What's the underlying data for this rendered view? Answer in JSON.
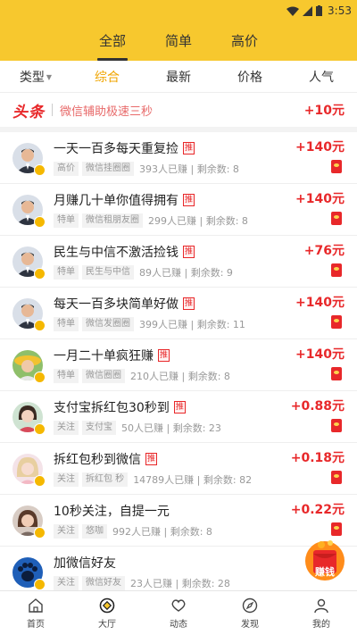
{
  "status_bar": {
    "time": "3:53"
  },
  "top_tabs": [
    {
      "label": "全部",
      "active": true
    },
    {
      "label": "简单",
      "active": false
    },
    {
      "label": "高价",
      "active": false
    }
  ],
  "filters": [
    {
      "label": "类型",
      "active": false,
      "has_caret": true
    },
    {
      "label": "综合",
      "active": true
    },
    {
      "label": "最新",
      "active": false
    },
    {
      "label": "价格",
      "active": false
    },
    {
      "label": "人气",
      "active": false
    }
  ],
  "banner": {
    "logo": "头条",
    "text": "微信辅助极速三秒",
    "amount": "+10元"
  },
  "tasks": [
    {
      "title": "一天一百多每天重复捡",
      "tag": "推",
      "chips": [
        "高价",
        "微信挂圈圈"
      ],
      "stats": "393人已赚 | 剩余数: 8",
      "amount": "+140元",
      "avatar": "man"
    },
    {
      "title": "月赚几十单你值得拥有",
      "tag": "推",
      "chips": [
        "特单",
        "微信租朋友圈"
      ],
      "stats": "299人已赚 | 剩余数: 8",
      "amount": "+140元",
      "avatar": "man"
    },
    {
      "title": "民生与中信不激活捡钱",
      "tag": "推",
      "chips": [
        "特单",
        "民生与中信"
      ],
      "stats": "89人已赚 | 剩余数: 9",
      "amount": "+76元",
      "avatar": "man"
    },
    {
      "title": "每天一百多块简单好做",
      "tag": "推",
      "chips": [
        "特单",
        "微信发圈圈"
      ],
      "stats": "399人已赚 | 剩余数: 11",
      "amount": "+140元",
      "avatar": "man"
    },
    {
      "title": "一月二十单疯狂赚",
      "tag": "推",
      "chips": [
        "特单",
        "微信圈圈"
      ],
      "stats": "210人已赚 | 剩余数: 8",
      "amount": "+140元",
      "avatar": "hat"
    },
    {
      "title": "支付宝拆红包30秒到",
      "tag": "推",
      "chips": [
        "关注",
        "支付宝"
      ],
      "stats": "50人已赚 | 剩余数: 23",
      "amount": "+0.88元",
      "avatar": "woman"
    },
    {
      "title": "拆红包秒到微信",
      "tag": "推",
      "chips": [
        "关注",
        "拆红包 秒"
      ],
      "stats": "14789人已赚 | 剩余数: 82",
      "amount": "+0.18元",
      "avatar": "blonde"
    },
    {
      "title": "10秒关注，自提一元",
      "tag": "",
      "chips": [
        "关注",
        "悠咖"
      ],
      "stats": "992人已赚 | 剩余数: 8",
      "amount": "+0.22元",
      "avatar": "girl"
    },
    {
      "title": "加微信好友",
      "tag": "",
      "chips": [
        "关注",
        "微信好友"
      ],
      "stats": "23人已赚 | 剩余数: 28",
      "amount": "",
      "avatar": "paw"
    }
  ],
  "floater": {
    "label": "赚钱"
  },
  "tabbar": [
    {
      "label": "首页",
      "icon": "home-icon"
    },
    {
      "label": "大厅",
      "icon": "hall-icon"
    },
    {
      "label": "动态",
      "icon": "heart-icon"
    },
    {
      "label": "发现",
      "icon": "compass-icon"
    },
    {
      "label": "我的",
      "icon": "user-icon"
    }
  ],
  "colors": {
    "accent": "#f7c82e",
    "red": "#e8282a",
    "active_filter": "#f0a500"
  }
}
